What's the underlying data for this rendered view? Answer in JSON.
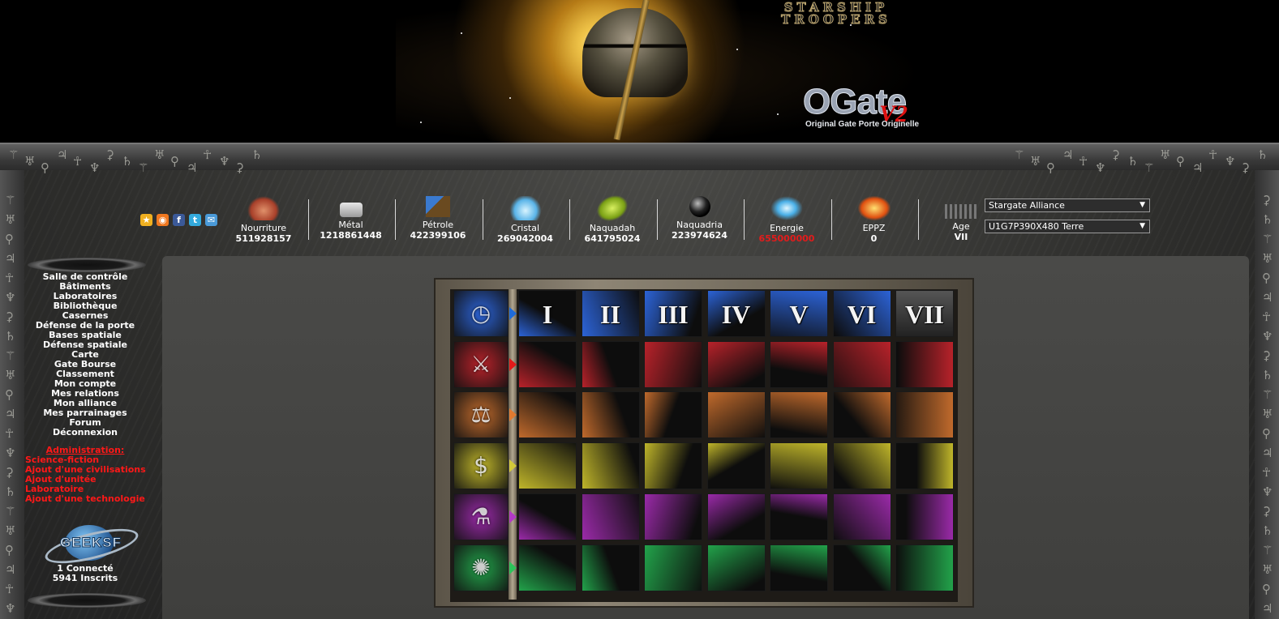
{
  "banner": {
    "subtitle_logo": "STARSHIP TROOPERS",
    "logo_title": "OGate",
    "logo_version": "V2",
    "logo_tagline": "Original Gate Porte Originelle"
  },
  "quick_icons": [
    {
      "name": "favorites",
      "glyph": "★",
      "color": "#f0b020"
    },
    {
      "name": "rss",
      "glyph": "◉",
      "color": "#f07820"
    },
    {
      "name": "facebook",
      "glyph": "f",
      "color": "#3b5998"
    },
    {
      "name": "twitter",
      "glyph": "t",
      "color": "#33aadd"
    },
    {
      "name": "messenger",
      "glyph": "✉",
      "color": "#4a9ad8"
    }
  ],
  "resources": [
    {
      "name": "Nourriture",
      "value": "511928157",
      "icon": "meat-icon",
      "alert": false
    },
    {
      "name": "Métal",
      "value": "1218861448",
      "icon": "metal-ingots-icon",
      "alert": false
    },
    {
      "name": "Pétrole",
      "value": "422399106",
      "icon": "oil-pump-icon",
      "alert": false
    },
    {
      "name": "Cristal",
      "value": "269042004",
      "icon": "crystal-icon",
      "alert": false
    },
    {
      "name": "Naquadah",
      "value": "641795024",
      "icon": "naquadah-icon",
      "alert": false
    },
    {
      "name": "Naquadria",
      "value": "223974624",
      "icon": "naquadria-orb-icon",
      "alert": false
    },
    {
      "name": "Energie",
      "value": "655000000",
      "icon": "lightning-icon",
      "alert": true
    },
    {
      "name": "EPPZ",
      "value": "0",
      "icon": "eppz-module-icon",
      "alert": false
    },
    {
      "name": "Age",
      "value": "VII",
      "icon": "evolution-icon",
      "alert": false
    }
  ],
  "selects": {
    "alliance": "Stargate Alliance",
    "planet": "U1G7P390X480 Terre"
  },
  "nav": {
    "links": [
      "Salle de contrôle",
      "Bâtiments",
      "Laboratoires",
      "Bibliothèque",
      "Casernes",
      "Défense de la porte",
      "Bases spatiale",
      "Défense spatiale",
      "Carte",
      "Gate Bourse",
      "Classement",
      "Mon compte",
      "Mes relations",
      "Mon alliance",
      "Mes parrainages",
      "Forum",
      "Déconnexion"
    ],
    "admin_heading": "Administration:",
    "admin_links": [
      "Science-fiction",
      "Ajout d'une civilisations",
      "Ajout d'unitée",
      "Laboratoire",
      "Ajout d'une technologie"
    ],
    "partner_logo": "GEEKSF",
    "connected": "1 Connecté",
    "registered": "5941 Inscrits"
  },
  "tech_tree": {
    "age_headers": [
      "I",
      "II",
      "III",
      "IV",
      "V",
      "VI",
      "VII"
    ],
    "rows": [
      {
        "category": "ages",
        "color": "#2c63d6",
        "arrow": "#1e6ad8",
        "icon": "clock-icon",
        "glyph": "◷",
        "cells": [
          "",
          "",
          "",
          "",
          "",
          "",
          ""
        ]
      },
      {
        "category": "military",
        "color": "#b8222a",
        "arrow": "#e11a1a",
        "icon": "soldiers-icon",
        "glyph": "⚔",
        "cells": [
          "radar-icon",
          "eye-icon",
          "laser-icon",
          "planet-icon",
          "satellite-dish-icon",
          "warship-icon",
          "energy-core-icon"
        ]
      },
      {
        "category": "politics",
        "color": "#c06a2c",
        "arrow": "#e07a30",
        "icon": "scales-icon",
        "glyph": "⚖",
        "cells": [
          "building-icon",
          "gavel-icon",
          "book-icon",
          "eiffel-tower-icon",
          "city-icon",
          "map-icon",
          "door-icon"
        ]
      },
      {
        "category": "economy",
        "color": "#bfb52a",
        "arrow": "#d2c83a",
        "icon": "money-icon",
        "glyph": "$",
        "cells": [
          "banknotes-icon",
          "circuit-icon",
          "investor-icon",
          "coins-chart-icon",
          "magnifier-icon",
          "gyroscope-icon",
          "forbidden-icon"
        ]
      },
      {
        "category": "science",
        "color": "#9a2aa8",
        "arrow": "#b23ac4",
        "icon": "lab-icon",
        "glyph": "⚗",
        "cells": [
          "magnet-icon",
          "gears-icon",
          "ufo-icon",
          "reactor-icon",
          "space-station-icon",
          "engine-icon",
          "nebula-icon"
        ]
      },
      {
        "category": "energy",
        "color": "#22a24a",
        "arrow": "#2ec25a",
        "icon": "bulb-icon",
        "glyph": "✺",
        "cells": [
          "light-bulb-icon",
          "plant-icon",
          "terrain-icon",
          "wire-icon",
          "grid-icon",
          "map-terminal-icon",
          "radioactive-barrel-icon"
        ]
      }
    ]
  }
}
